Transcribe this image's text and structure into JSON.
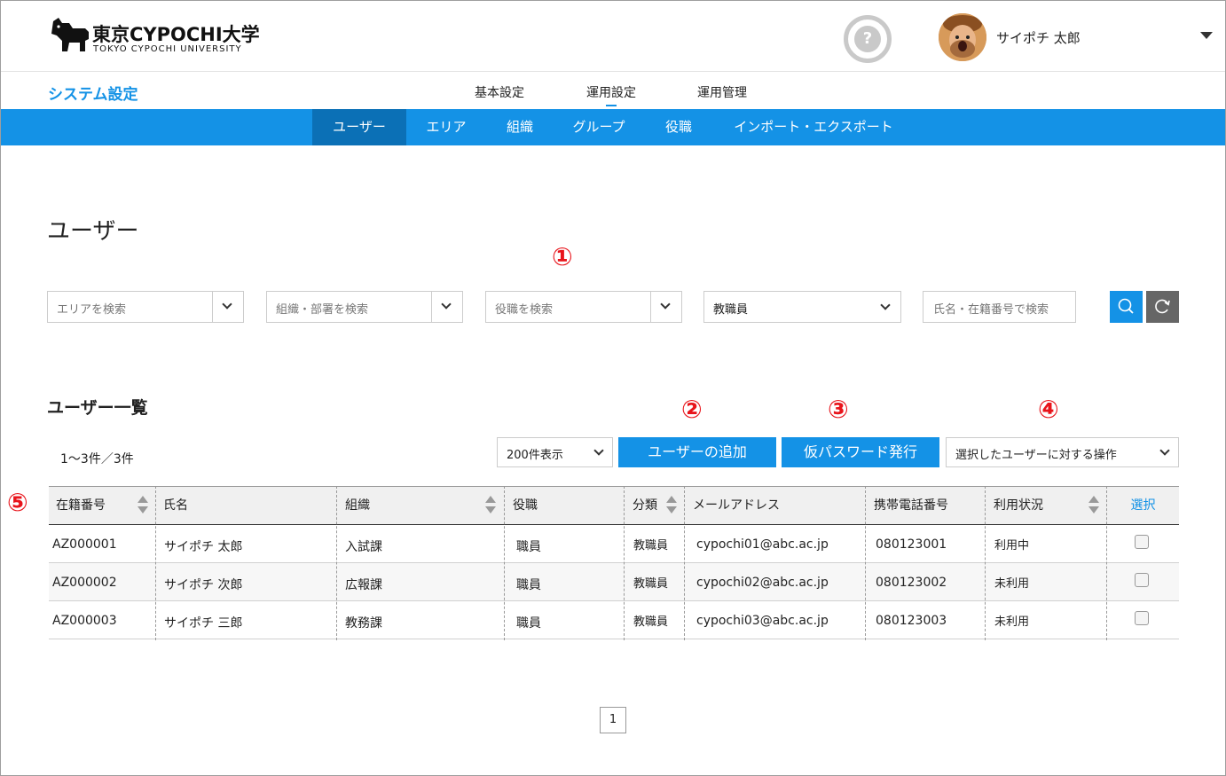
{
  "header": {
    "logo_name": "東京CYPOCHI大学",
    "logo_sub": "TOKYO CYPOCHI UNIVERSITY",
    "help_label": "?",
    "user_name": "サイポチ 太郎"
  },
  "subheader": {
    "title": "システム設定",
    "nav": [
      "基本設定",
      "運用設定",
      "運用管理"
    ],
    "active_nav": "運用設定"
  },
  "tabs": [
    "ユーザー",
    "エリア",
    "組織",
    "グループ",
    "役職",
    "インポート・エクスポート"
  ],
  "active_tab": "ユーザー",
  "page_title": "ユーザー",
  "markers": [
    "①",
    "②",
    "③",
    "④",
    "⑤"
  ],
  "filters": {
    "area_placeholder": "エリアを検索",
    "org_placeholder": "組織・部署を検索",
    "role_placeholder": "役職を検索",
    "category_value": "教職員",
    "name_placeholder": "氏名・在籍番号で検索"
  },
  "list": {
    "title": "ユーザー一覧",
    "count": "1〜3件／3件",
    "per_page": "200件表示",
    "add_user": "ユーザーの追加",
    "issue_password": "仮パスワード発行",
    "bulk_action": "選択したユーザーに対する操作"
  },
  "table": {
    "headers": [
      "在籍番号",
      "氏名",
      "組織",
      "役職",
      "分類",
      "メールアドレス",
      "携帯電話番号",
      "利用状況",
      "選択"
    ],
    "rows": [
      [
        "AZ000001",
        "サイポチ 太郎",
        "入試課",
        "職員",
        "教職員",
        "cypochi01@abc.ac.jp",
        "080123001",
        "利用中"
      ],
      [
        "AZ000002",
        "サイポチ 次郎",
        "広報課",
        "職員",
        "教職員",
        "cypochi02@abc.ac.jp",
        "080123002",
        "未利用"
      ],
      [
        "AZ000003",
        "サイポチ 三郎",
        "教務課",
        "職員",
        "教職員",
        "cypochi03@abc.ac.jp",
        "080123003",
        "未利用"
      ]
    ]
  },
  "pagination": {
    "current": "1"
  },
  "colors": {
    "accent": "#1492e6",
    "accent_dark": "#0b70b6",
    "marker": "#e8141b"
  }
}
